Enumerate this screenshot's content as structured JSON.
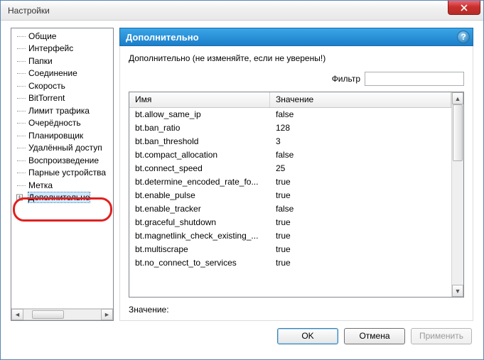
{
  "window": {
    "title": "Настройки"
  },
  "sidebar": {
    "items": [
      {
        "label": "Общие"
      },
      {
        "label": "Интерфейс"
      },
      {
        "label": "Папки"
      },
      {
        "label": "Соединение"
      },
      {
        "label": "Скорость"
      },
      {
        "label": "BitTorrent"
      },
      {
        "label": "Лимит трафика"
      },
      {
        "label": "Очерёдность"
      },
      {
        "label": "Планировщик"
      },
      {
        "label": "Удалённый доступ"
      },
      {
        "label": "Воспроизведение"
      },
      {
        "label": "Парные устройства"
      },
      {
        "label": "Метка"
      },
      {
        "label": "Дополнительно",
        "selected": true,
        "expandable": true
      }
    ]
  },
  "panel": {
    "title": "Дополнительно",
    "warning": "Дополнительно (не изменяйте, если не уверены!)",
    "filter_label": "Фильтр",
    "filter_value": "",
    "columns": {
      "name": "Имя",
      "value": "Значение"
    },
    "rows": [
      {
        "name": "bt.allow_same_ip",
        "value": "false"
      },
      {
        "name": "bt.ban_ratio",
        "value": "128"
      },
      {
        "name": "bt.ban_threshold",
        "value": "3"
      },
      {
        "name": "bt.compact_allocation",
        "value": "false"
      },
      {
        "name": "bt.connect_speed",
        "value": "25"
      },
      {
        "name": "bt.determine_encoded_rate_fo...",
        "value": "true"
      },
      {
        "name": "bt.enable_pulse",
        "value": "true"
      },
      {
        "name": "bt.enable_tracker",
        "value": "false"
      },
      {
        "name": "bt.graceful_shutdown",
        "value": "true"
      },
      {
        "name": "bt.magnetlink_check_existing_...",
        "value": "true"
      },
      {
        "name": "bt.multiscrape",
        "value": "true"
      },
      {
        "name": "bt.no_connect_to_services",
        "value": "true"
      }
    ],
    "value_label": "Значение:"
  },
  "footer": {
    "ok": "OK",
    "cancel": "Отмена",
    "apply": "Применить"
  },
  "help_glyph": "?"
}
